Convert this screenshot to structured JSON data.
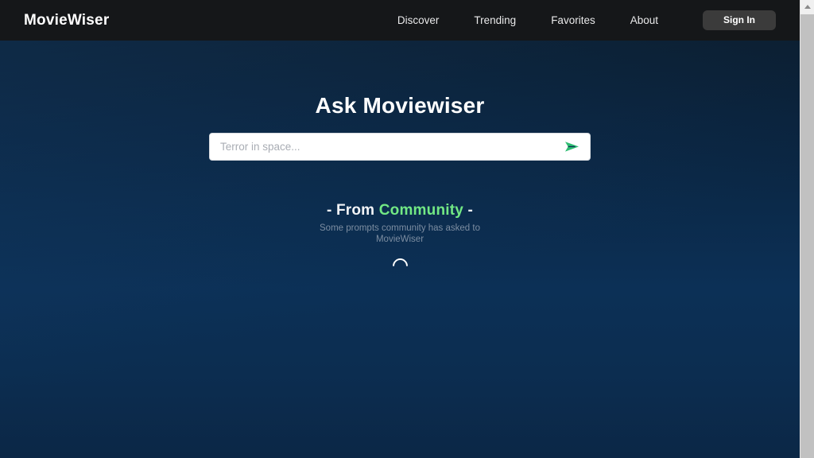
{
  "header": {
    "logo": "MovieWiser",
    "nav": [
      {
        "label": "Discover"
      },
      {
        "label": "Trending"
      },
      {
        "label": "Favorites"
      },
      {
        "label": "About"
      }
    ],
    "sign_in_label": "Sign In"
  },
  "hero": {
    "title": "Ask Moviewiser",
    "search_placeholder": "Terror in space...",
    "search_value": "",
    "send_icon": "send-paper-plane-icon"
  },
  "community": {
    "heading_prefix": "- From ",
    "heading_accent": "Community",
    "heading_suffix": " -",
    "subtitle": "Some prompts community has asked to MovieWiser",
    "loading_icon": "spinner-icon"
  },
  "scrollbar": {
    "up_arrow_icon": "scroll-up-arrow-icon"
  },
  "colors": {
    "accent_green": "#72e884",
    "header_bg": "#151719",
    "page_bg_top": "#0b1420",
    "page_bg_bottom": "#0b2746",
    "signin_bg": "#3b3b3b"
  }
}
